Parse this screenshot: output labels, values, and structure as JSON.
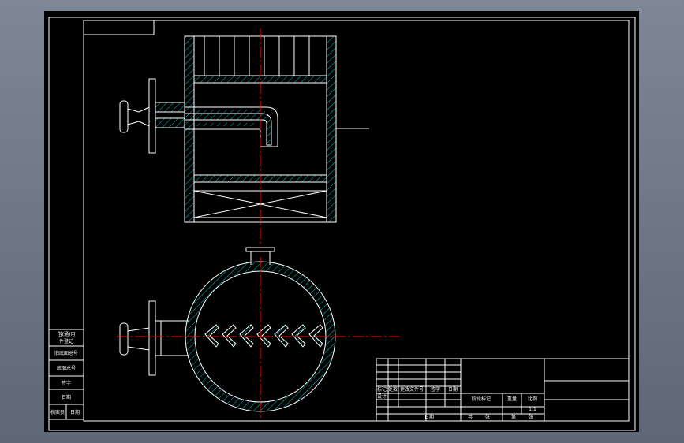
{
  "title_block": {
    "left_labels": [
      "借(通)用",
      "件登记",
      "旧底图总号",
      "底图总号",
      "签字",
      "日期",
      "档案员",
      "日期"
    ],
    "header_labels": [
      "标记",
      "处数",
      "更改文件号",
      "签字",
      "日期"
    ],
    "role_labels": [
      "设计",
      "日期"
    ],
    "stage_labels": [
      "阶段标记",
      "重量",
      "比例"
    ],
    "scale": "1:1",
    "sheet_labels": [
      "共",
      "张",
      "第",
      "张"
    ]
  },
  "colors": {
    "lines": "#ffffff",
    "centerline": "#ff0000",
    "hatch": "#00c8c8",
    "background": "#000000"
  }
}
